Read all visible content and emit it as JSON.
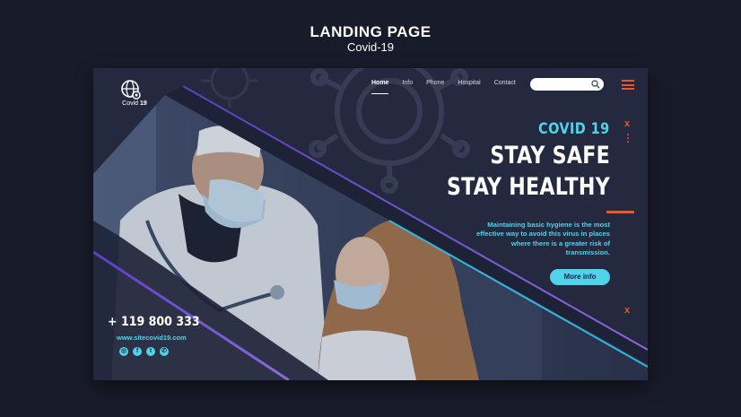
{
  "showcase": {
    "title": "LANDING PAGE",
    "subtitle": "Covid-19"
  },
  "logo": {
    "text_prefix": "Covid",
    "text_number": "19",
    "icon": "globe-virus-icon"
  },
  "nav": {
    "items": [
      {
        "label": "Home",
        "active": true
      },
      {
        "label": "Info",
        "active": false
      },
      {
        "label": "Phone",
        "active": false
      },
      {
        "label": "Hospital",
        "active": false
      },
      {
        "label": "Contact",
        "active": false
      }
    ]
  },
  "search": {
    "value": "",
    "icon": "search-icon"
  },
  "hero": {
    "kicker": "COVID 19",
    "line1": "STAY SAFE",
    "line2": "STAY HEALTHY",
    "body": "Maintaining basic hygiene is the most effective way to avoid this virus in places where there is a greater risk of transmission.",
    "cta_label": "More info"
  },
  "decor": {
    "close_symbol": "x"
  },
  "contact": {
    "phone": "+ 119 800 333",
    "website": "www.sitecovid19.com"
  },
  "socials": [
    {
      "icon": "instagram-icon",
      "glyph": "◎"
    },
    {
      "icon": "facebook-icon",
      "glyph": "f"
    },
    {
      "icon": "twitter-icon",
      "glyph": "t"
    },
    {
      "icon": "whatsapp-icon",
      "glyph": "✆"
    }
  ],
  "colors": {
    "background": "#181b29",
    "panel": "#24293f",
    "accent_cyan": "#4fd3ea",
    "accent_orange": "#e8582c",
    "diagonal_purple": "#7a55d0"
  }
}
